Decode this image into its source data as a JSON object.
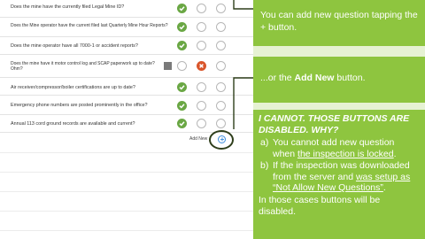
{
  "questions": [
    {
      "text": "Does the mine have the currently filed Legal Mine ID?",
      "answer": "yes"
    },
    {
      "text": "Does the Mine operator have the current filed last Quarterly Mine Hour Reports?",
      "answer": "yes"
    },
    {
      "text": "Does the mine operator have all 7000-1 or accident reports?",
      "answer": "yes"
    },
    {
      "text": "Does the mine have it motor control log and SCAP paperwork up to date? Ohm?",
      "answer": "no"
    },
    {
      "text": "Air receiver/compressor/boiler certifications are up to date?",
      "answer": "yes"
    },
    {
      "text": "Emergency phone numbers are posted prominently in the office?",
      "answer": "yes"
    },
    {
      "text": "Annual 113 cord ground records are available and current?",
      "answer": "yes"
    }
  ],
  "add_new_label": "Add New",
  "callouts": {
    "box1": "You can add new question tapping the + button.",
    "box2_pre": "...or the ",
    "box2_bold": "Add New",
    "box2_post": " button.",
    "box3_heading": "I CANNOT. THOSE BUTTONS ARE DISABLED. WHY?",
    "item_a_marker": "a)",
    "item_a_pre": "You cannot add new question when ",
    "item_a_underlined": "the inspection is locked",
    "item_a_post": ".",
    "item_b_marker": "b)",
    "item_b_pre": "If the inspection was downloaded from the server and ",
    "item_b_underlined": "was setup as “Not Allow New Questions”",
    "item_b_post": ".",
    "footer": "In those cases buttons will be disabled."
  },
  "colors": {
    "panel_green": "#8ec53f",
    "panel_bg": "#e6f2d3",
    "yes_green": "#6aa744",
    "no_orange": "#d9552b",
    "add_blue": "#3c8ddc"
  }
}
